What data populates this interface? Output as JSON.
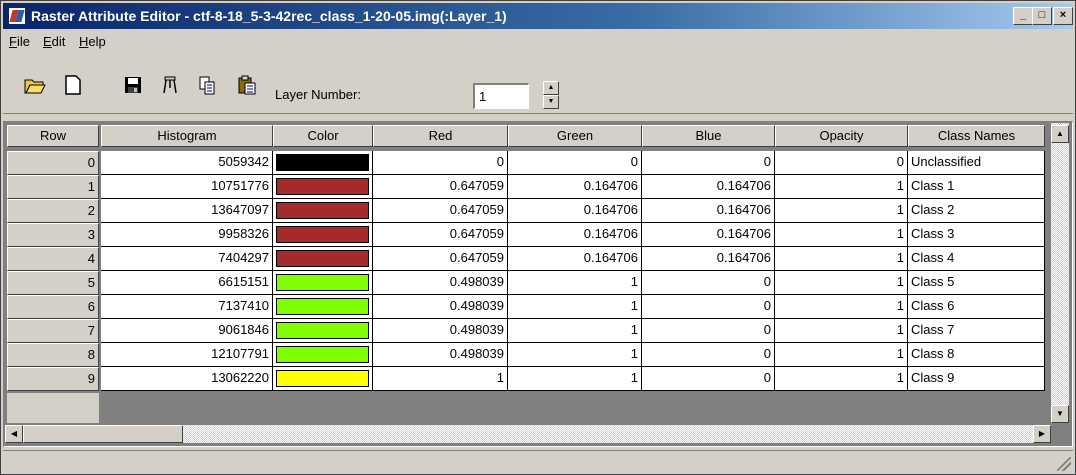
{
  "window": {
    "title": "Raster Attribute Editor - ctf-8-18_5-3-42rec_class_1-20-05.img(:Layer_1)",
    "controls": [
      "_",
      "□",
      "×"
    ]
  },
  "menu": [
    {
      "label": "File",
      "u": "F",
      "rest": "ile"
    },
    {
      "label": "Edit",
      "u": "E",
      "rest": "dit"
    },
    {
      "label": "Help",
      "u": "H",
      "rest": "elp"
    }
  ],
  "toolbar": {
    "tools": [
      "open-folder-icon",
      "new-document-icon",
      "save-icon",
      "compass-icon",
      "copy-icon",
      "paste-icon"
    ],
    "layer_label": "Layer Number:",
    "layer_value": "1"
  },
  "grid": {
    "columns": [
      "Row",
      "Histogram",
      "Color",
      "Red",
      "Green",
      "Blue",
      "Opacity",
      "Class Names"
    ],
    "rows": [
      {
        "row": "0",
        "histogram": "5059342",
        "color": "#000000",
        "red": "0",
        "green": "0",
        "blue": "0",
        "opacity": "0",
        "name": "Unclassified"
      },
      {
        "row": "1",
        "histogram": "10751776",
        "color": "#a52a2a",
        "red": "0.647059",
        "green": "0.164706",
        "blue": "0.164706",
        "opacity": "1",
        "name": "Class 1"
      },
      {
        "row": "2",
        "histogram": "13647097",
        "color": "#a52a2a",
        "red": "0.647059",
        "green": "0.164706",
        "blue": "0.164706",
        "opacity": "1",
        "name": "Class 2"
      },
      {
        "row": "3",
        "histogram": "9958326",
        "color": "#a52a2a",
        "red": "0.647059",
        "green": "0.164706",
        "blue": "0.164706",
        "opacity": "1",
        "name": "Class 3"
      },
      {
        "row": "4",
        "histogram": "7404297",
        "color": "#a52a2a",
        "red": "0.647059",
        "green": "0.164706",
        "blue": "0.164706",
        "opacity": "1",
        "name": "Class 4"
      },
      {
        "row": "5",
        "histogram": "6615151",
        "color": "#7fff00",
        "red": "0.498039",
        "green": "1",
        "blue": "0",
        "opacity": "1",
        "name": "Class 5"
      },
      {
        "row": "6",
        "histogram": "7137410",
        "color": "#7fff00",
        "red": "0.498039",
        "green": "1",
        "blue": "0",
        "opacity": "1",
        "name": "Class 6"
      },
      {
        "row": "7",
        "histogram": "9061846",
        "color": "#7fff00",
        "red": "0.498039",
        "green": "1",
        "blue": "0",
        "opacity": "1",
        "name": "Class 7"
      },
      {
        "row": "8",
        "histogram": "12107791",
        "color": "#7fff00",
        "red": "0.498039",
        "green": "1",
        "blue": "0",
        "opacity": "1",
        "name": "Class 8"
      },
      {
        "row": "9",
        "histogram": "13062220",
        "color": "#ffff00",
        "red": "1",
        "green": "1",
        "blue": "0",
        "opacity": "1",
        "name": "Class 9"
      }
    ]
  }
}
